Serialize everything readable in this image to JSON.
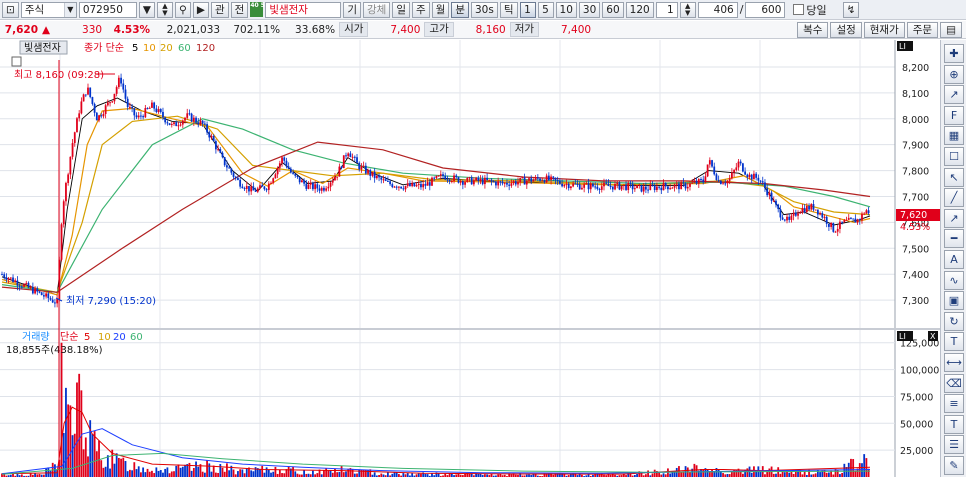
{
  "toolbar": {
    "market": "주식",
    "code": "072950",
    "btn_gwan": "관",
    "btn_jeon": "전",
    "badge": "40 50",
    "stock_name": "빛샘전자",
    "btn_gi": "기",
    "btn_gangche": "강체",
    "periods": [
      "일",
      "주",
      "월",
      "분",
      "30s",
      "틱"
    ],
    "intervals": [
      "1",
      "5",
      "10",
      "30",
      "60",
      "120"
    ],
    "active_interval": "1",
    "spin_value": "1",
    "count_value": "406",
    "count_total": "600",
    "today_label": "당일"
  },
  "quote": {
    "price": "7,620",
    "change_arrow": "▲",
    "change": "330",
    "change_pct": "4.53%",
    "volume": "2,021,033",
    "vol_ratio": "702.11%",
    "turnover": "33.68%",
    "open_label": "시가",
    "open": "7,400",
    "high_label": "고가",
    "high": "8,160",
    "low_label": "저가",
    "low": "7,400",
    "btn_restore": "복수",
    "btn_settings": "설정",
    "btn_current": "현재가",
    "btn_order": "주문"
  },
  "price_panel": {
    "name_tab": "빛샘전자",
    "legend_prefix": "종가 단순",
    "ma_labels": [
      "5",
      "10",
      "20",
      "60",
      "120"
    ],
    "ma_colors": [
      "#000000",
      "#e69500",
      "#d4a000",
      "#3cb371",
      "#b22222"
    ],
    "high_annotation": "최고 8,160 (09:28)",
    "low_annotation": "최저 7,290 (15:20)",
    "current_tag": "7,620",
    "current_pct_tag": "4.53%",
    "lin_label": "LI",
    "y_ticks": [
      "8,200",
      "8,100",
      "8,000",
      "7,900",
      "7,800",
      "7,700",
      "7,600",
      "7,500",
      "7,400",
      "7,300"
    ]
  },
  "volume_panel": {
    "legend_name": "거래량",
    "legend_prefix": "단순",
    "ma_labels": [
      "5",
      "10",
      "20",
      "60"
    ],
    "ma_colors": [
      "#e00000",
      "#d4a000",
      "#1e40ff",
      "#3cb371"
    ],
    "info": "18,855주(438.18%)",
    "lin_label": "LI",
    "close_label": "X",
    "y_ticks": [
      "125,000",
      "100,000",
      "75,000",
      "50,000",
      "25,000"
    ]
  },
  "colors": {
    "up": "#e0001a",
    "down": "#0033cc",
    "ma5": "#000000",
    "ma10": "#e69500",
    "ma20": "#d4a000",
    "ma60": "#3cb371",
    "ma120": "#b22222"
  },
  "side_toolbar_icons": [
    "crosshair-icon",
    "magnet-icon",
    "trend-icon",
    "fibo-icon",
    "pattern-icon",
    "text-note-icon",
    "pointer-icon",
    "line-icon",
    "ray-icon",
    "horizontal-line-icon",
    "auto-icon",
    "wave-icon",
    "period-icon",
    "refresh-icon",
    "text-tool-icon",
    "ruler-icon",
    "eraser-icon",
    "select-all-icon",
    "text-box-icon",
    "indicator-icon",
    "edit-icon"
  ],
  "chart_data": {
    "type": "line",
    "title": "빛샘전자",
    "ylim": [
      7200,
      8250
    ],
    "volume_ylim": [
      0,
      135000
    ],
    "x_count": 406,
    "price_series": [
      {
        "name": "close",
        "points": [
          [
            0,
            7400
          ],
          [
            15,
            7370
          ],
          [
            30,
            7340
          ],
          [
            45,
            7310
          ],
          [
            55,
            7290
          ],
          [
            60,
            7650
          ],
          [
            70,
            7900
          ],
          [
            78,
            8050
          ],
          [
            85,
            8120
          ],
          [
            95,
            8000
          ],
          [
            110,
            8080
          ],
          [
            118,
            8160
          ],
          [
            125,
            8050
          ],
          [
            135,
            8000
          ],
          [
            150,
            8050
          ],
          [
            170,
            7970
          ],
          [
            185,
            8010
          ],
          [
            200,
            7980
          ],
          [
            210,
            7920
          ],
          [
            220,
            7840
          ],
          [
            235,
            7760
          ],
          [
            250,
            7720
          ],
          [
            265,
            7740
          ],
          [
            280,
            7850
          ],
          [
            290,
            7780
          ],
          [
            305,
            7740
          ],
          [
            320,
            7730
          ],
          [
            335,
            7790
          ],
          [
            345,
            7880
          ],
          [
            355,
            7820
          ],
          [
            370,
            7780
          ],
          [
            385,
            7750
          ],
          [
            400,
            7740
          ],
          [
            420,
            7740
          ],
          [
            440,
            7780
          ],
          [
            460,
            7760
          ],
          [
            480,
            7760
          ],
          [
            500,
            7750
          ],
          [
            520,
            7760
          ],
          [
            540,
            7770
          ],
          [
            560,
            7750
          ],
          [
            580,
            7740
          ],
          [
            600,
            7740
          ],
          [
            620,
            7740
          ],
          [
            640,
            7730
          ],
          [
            660,
            7740
          ],
          [
            680,
            7740
          ],
          [
            700,
            7760
          ],
          [
            705,
            7840
          ],
          [
            715,
            7760
          ],
          [
            725,
            7760
          ],
          [
            735,
            7830
          ],
          [
            745,
            7780
          ],
          [
            755,
            7770
          ],
          [
            765,
            7710
          ],
          [
            775,
            7640
          ],
          [
            785,
            7600
          ],
          [
            795,
            7650
          ],
          [
            810,
            7660
          ],
          [
            820,
            7620
          ],
          [
            830,
            7570
          ],
          [
            840,
            7600
          ],
          [
            855,
            7610
          ],
          [
            862,
            7650
          ],
          [
            866,
            7620
          ]
        ]
      },
      {
        "name": "5",
        "points": [
          [
            0,
            7390
          ],
          [
            30,
            7350
          ],
          [
            55,
            7320
          ],
          [
            65,
            7650
          ],
          [
            80,
            8000
          ],
          [
            95,
            8050
          ],
          [
            115,
            8080
          ],
          [
            140,
            8030
          ],
          [
            170,
            7990
          ],
          [
            200,
            7980
          ],
          [
            230,
            7800
          ],
          [
            255,
            7720
          ],
          [
            280,
            7830
          ],
          [
            305,
            7750
          ],
          [
            330,
            7760
          ],
          [
            345,
            7850
          ],
          [
            370,
            7790
          ],
          [
            400,
            7745
          ],
          [
            440,
            7770
          ],
          [
            500,
            7755
          ],
          [
            560,
            7755
          ],
          [
            620,
            7742
          ],
          [
            680,
            7742
          ],
          [
            705,
            7800
          ],
          [
            735,
            7790
          ],
          [
            760,
            7740
          ],
          [
            780,
            7630
          ],
          [
            800,
            7640
          ],
          [
            830,
            7590
          ],
          [
            855,
            7610
          ],
          [
            866,
            7625
          ]
        ]
      },
      {
        "name": "10",
        "points": [
          [
            0,
            7380
          ],
          [
            55,
            7320
          ],
          [
            70,
            7550
          ],
          [
            85,
            7900
          ],
          [
            100,
            8030
          ],
          [
            130,
            8040
          ],
          [
            170,
            8000
          ],
          [
            205,
            7970
          ],
          [
            240,
            7790
          ],
          [
            265,
            7740
          ],
          [
            290,
            7800
          ],
          [
            320,
            7750
          ],
          [
            345,
            7810
          ],
          [
            380,
            7790
          ],
          [
            420,
            7760
          ],
          [
            500,
            7755
          ],
          [
            600,
            7745
          ],
          [
            700,
            7750
          ],
          [
            740,
            7780
          ],
          [
            770,
            7720
          ],
          [
            790,
            7660
          ],
          [
            820,
            7630
          ],
          [
            850,
            7600
          ],
          [
            866,
            7615
          ]
        ]
      },
      {
        "name": "20",
        "points": [
          [
            0,
            7370
          ],
          [
            55,
            7330
          ],
          [
            80,
            7600
          ],
          [
            100,
            7900
          ],
          [
            130,
            7990
          ],
          [
            175,
            8010
          ],
          [
            215,
            7960
          ],
          [
            250,
            7820
          ],
          [
            290,
            7800
          ],
          [
            330,
            7780
          ],
          [
            380,
            7790
          ],
          [
            430,
            7765
          ],
          [
            520,
            7760
          ],
          [
            620,
            7745
          ],
          [
            720,
            7760
          ],
          [
            760,
            7740
          ],
          [
            790,
            7680
          ],
          [
            830,
            7640
          ],
          [
            866,
            7630
          ]
        ]
      },
      {
        "name": "60",
        "points": [
          [
            0,
            7360
          ],
          [
            55,
            7330
          ],
          [
            100,
            7650
          ],
          [
            150,
            7900
          ],
          [
            200,
            8000
          ],
          [
            240,
            7960
          ],
          [
            290,
            7880
          ],
          [
            340,
            7830
          ],
          [
            400,
            7790
          ],
          [
            480,
            7770
          ],
          [
            560,
            7760
          ],
          [
            640,
            7750
          ],
          [
            720,
            7755
          ],
          [
            780,
            7740
          ],
          [
            830,
            7700
          ],
          [
            866,
            7660
          ]
        ]
      },
      {
        "name": "120",
        "points": [
          [
            0,
            7350
          ],
          [
            55,
            7330
          ],
          [
            120,
            7500
          ],
          [
            180,
            7650
          ],
          [
            250,
            7810
          ],
          [
            315,
            7910
          ],
          [
            380,
            7880
          ],
          [
            440,
            7810
          ],
          [
            520,
            7775
          ],
          [
            600,
            7760
          ],
          [
            680,
            7760
          ],
          [
            760,
            7750
          ],
          [
            820,
            7725
          ],
          [
            866,
            7700
          ]
        ]
      }
    ],
    "volume_series": [
      {
        "name": "거래량",
        "points": [
          [
            0,
            3000
          ],
          [
            20,
            2500
          ],
          [
            40,
            3000
          ],
          [
            58,
            15000
          ],
          [
            60,
            125000
          ],
          [
            62,
            60000
          ],
          [
            65,
            80000
          ],
          [
            70,
            55000
          ],
          [
            75,
            70000
          ],
          [
            78,
            85000
          ],
          [
            82,
            45000
          ],
          [
            88,
            40000
          ],
          [
            95,
            30000
          ],
          [
            105,
            20000
          ],
          [
            120,
            15000
          ],
          [
            140,
            10000
          ],
          [
            170,
            8000
          ],
          [
            210,
            12000
          ],
          [
            240,
            6000
          ],
          [
            280,
            9000
          ],
          [
            300,
            5000
          ],
          [
            340,
            8000
          ],
          [
            380,
            4000
          ],
          [
            430,
            3000
          ],
          [
            500,
            2500
          ],
          [
            560,
            3000
          ],
          [
            620,
            2500
          ],
          [
            700,
            10000
          ],
          [
            720,
            6000
          ],
          [
            760,
            8000
          ],
          [
            800,
            5000
          ],
          [
            830,
            6000
          ],
          [
            866,
            18855
          ]
        ]
      },
      {
        "name": "5",
        "points": [
          [
            0,
            3000
          ],
          [
            55,
            4000
          ],
          [
            62,
            50000
          ],
          [
            70,
            65000
          ],
          [
            80,
            60000
          ],
          [
            90,
            40000
          ],
          [
            110,
            22000
          ],
          [
            150,
            12000
          ],
          [
            210,
            10000
          ],
          [
            260,
            7000
          ],
          [
            340,
            6000
          ],
          [
            420,
            3500
          ],
          [
            520,
            2800
          ],
          [
            620,
            2700
          ],
          [
            700,
            7000
          ],
          [
            720,
            7000
          ],
          [
            760,
            6000
          ],
          [
            866,
            9000
          ]
        ]
      },
      {
        "name": "20",
        "points": [
          [
            0,
            3000
          ],
          [
            60,
            10000
          ],
          [
            80,
            40000
          ],
          [
            100,
            45000
          ],
          [
            130,
            30000
          ],
          [
            180,
            18000
          ],
          [
            240,
            12000
          ],
          [
            300,
            9000
          ],
          [
            380,
            6000
          ],
          [
            480,
            4000
          ],
          [
            600,
            3500
          ],
          [
            700,
            5000
          ],
          [
            780,
            6000
          ],
          [
            866,
            7000
          ]
        ]
      },
      {
        "name": "60",
        "points": [
          [
            0,
            2500
          ],
          [
            70,
            8000
          ],
          [
            110,
            20000
          ],
          [
            160,
            22000
          ],
          [
            220,
            17000
          ],
          [
            300,
            12000
          ],
          [
            400,
            8000
          ],
          [
            520,
            5500
          ],
          [
            640,
            4500
          ],
          [
            760,
            5000
          ],
          [
            866,
            5500
          ]
        ]
      }
    ]
  }
}
